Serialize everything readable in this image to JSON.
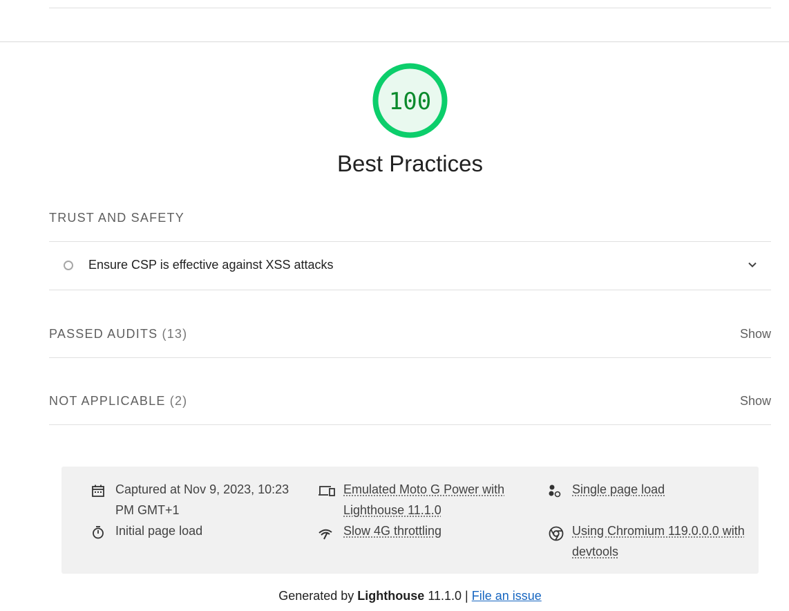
{
  "score": {
    "value": "100",
    "fraction": 1.0,
    "color": "#0cce6b",
    "fill_color": "#e9f9ef",
    "text_color": "#0b8a2c"
  },
  "category": {
    "title": "Best Practices"
  },
  "groups": {
    "trust_safety": {
      "title": "TRUST AND SAFETY",
      "audits": [
        {
          "title": "Ensure CSP is effective against XSS attacks",
          "icon": "informative-circle-icon"
        }
      ]
    },
    "passed": {
      "title": "PASSED AUDITS",
      "count": "(13)",
      "toggle": "Show"
    },
    "not_applicable": {
      "title": "NOT APPLICABLE",
      "count": "(2)",
      "toggle": "Show"
    }
  },
  "environment": {
    "captured_line1": "Captured at Nov 9, 2023, 10:23",
    "captured_line2": "PM GMT+1",
    "initial_load": "Initial page load",
    "emulated_line1": "Emulated Moto G Power with",
    "emulated_line2": "Lighthouse 11.1.0",
    "throttling": "Slow 4G throttling",
    "single_load": "Single page load",
    "chromium_line1": "Using Chromium 119.0.0.0 with",
    "chromium_line2": "devtools"
  },
  "footer": {
    "generated_by": "Generated by",
    "product": "Lighthouse",
    "version": "11.1.0 |",
    "issue_link": "File an issue"
  }
}
